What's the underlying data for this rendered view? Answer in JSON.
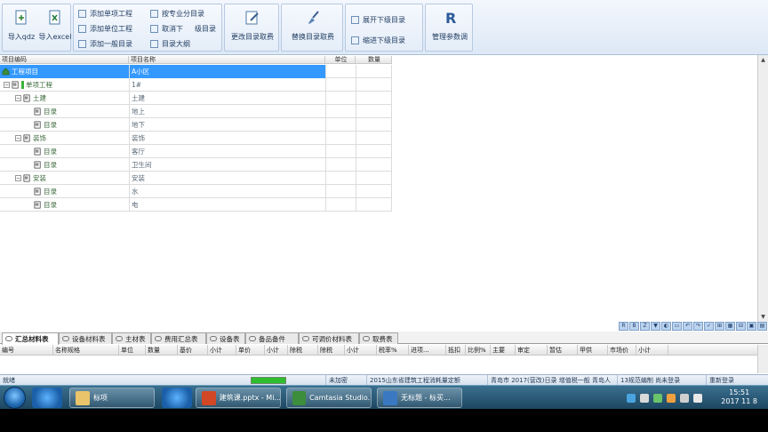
{
  "ribbon": {
    "import_qdz": "导入qdz",
    "import_excel": "导入excel",
    "add_unit_project": "添加单项工程",
    "add_unit_work": "添加单位工程",
    "add_general_dir": "添加一般目录",
    "by_specialty": "按专业分目录",
    "cancel_sub": "取消下",
    "sub_dir": "级目录",
    "dir_outline": "目录大纲",
    "change_dir": "更改目录取费",
    "apply_dir": "替换目录取费",
    "expand_sub": "展开下级目录",
    "collapse_sub": "缩进下级目录",
    "manage": "管理参数调"
  },
  "grid": {
    "headers": [
      "项目编码",
      "项目名称",
      "单位",
      "数量"
    ],
    "rows": [
      {
        "code": "工程项目",
        "name": "A小区",
        "level": 0,
        "toggle": "",
        "selected": true
      },
      {
        "code": "单项工程",
        "name": "1#",
        "level": 1,
        "toggle": "−",
        "selected": false
      },
      {
        "code": "土建",
        "name": "土建",
        "level": 2,
        "toggle": "−",
        "selected": false
      },
      {
        "code": "目录",
        "name": "地上",
        "level": 3,
        "toggle": "",
        "selected": false
      },
      {
        "code": "目录",
        "name": "地下",
        "level": 3,
        "toggle": "",
        "selected": false
      },
      {
        "code": "装饰",
        "name": "装饰",
        "level": 2,
        "toggle": "−",
        "selected": false
      },
      {
        "code": "目录",
        "name": "客厅",
        "level": 3,
        "toggle": "",
        "selected": false
      },
      {
        "code": "目录",
        "name": "卫生间",
        "level": 3,
        "toggle": "",
        "selected": false
      },
      {
        "code": "安装",
        "name": "安装",
        "level": 2,
        "toggle": "−",
        "selected": false
      },
      {
        "code": "目录",
        "name": "水",
        "level": 3,
        "toggle": "",
        "selected": false
      },
      {
        "code": "目录",
        "name": "电",
        "level": 3,
        "toggle": "",
        "selected": false
      }
    ]
  },
  "mini_tools": [
    "R",
    "B",
    "Z",
    "▼",
    "◐",
    "▭",
    "↶",
    "↷",
    "✓",
    "⊞",
    "▦",
    "⊟",
    "▣",
    "▤"
  ],
  "tabs": [
    "汇总材料表",
    "设备材料表",
    "主材表",
    "费用汇总表",
    "设备表",
    "备品备件",
    "可调价材料表",
    "取费表"
  ],
  "bottom_headers": [
    "编号",
    "名称规格",
    "单位",
    "数量",
    "基价",
    "小计",
    "单价",
    "小计",
    "除税",
    "除税",
    "小计",
    "税率%",
    "进项...",
    "抵扣",
    "比例%",
    "主要",
    "审定",
    "暂估",
    "甲供",
    "市场价",
    "小计"
  ],
  "status": {
    "left": "就绪",
    "progress": 100,
    "p1": "未加密",
    "p2": "2015山东省建筑工程消耗量定额",
    "p3": "青岛市 2017(营改)日录 增值税一般 青岛人",
    "p4": "13规范编制 尚未登录",
    "p5": "重新登录"
  },
  "taskbar": {
    "tasks": [
      "标项",
      "建筑课.pptx - Mi...",
      "Camtasia Studio...",
      "无标题 - 标买..."
    ],
    "time": "15:51",
    "date": "2017 11 8"
  }
}
